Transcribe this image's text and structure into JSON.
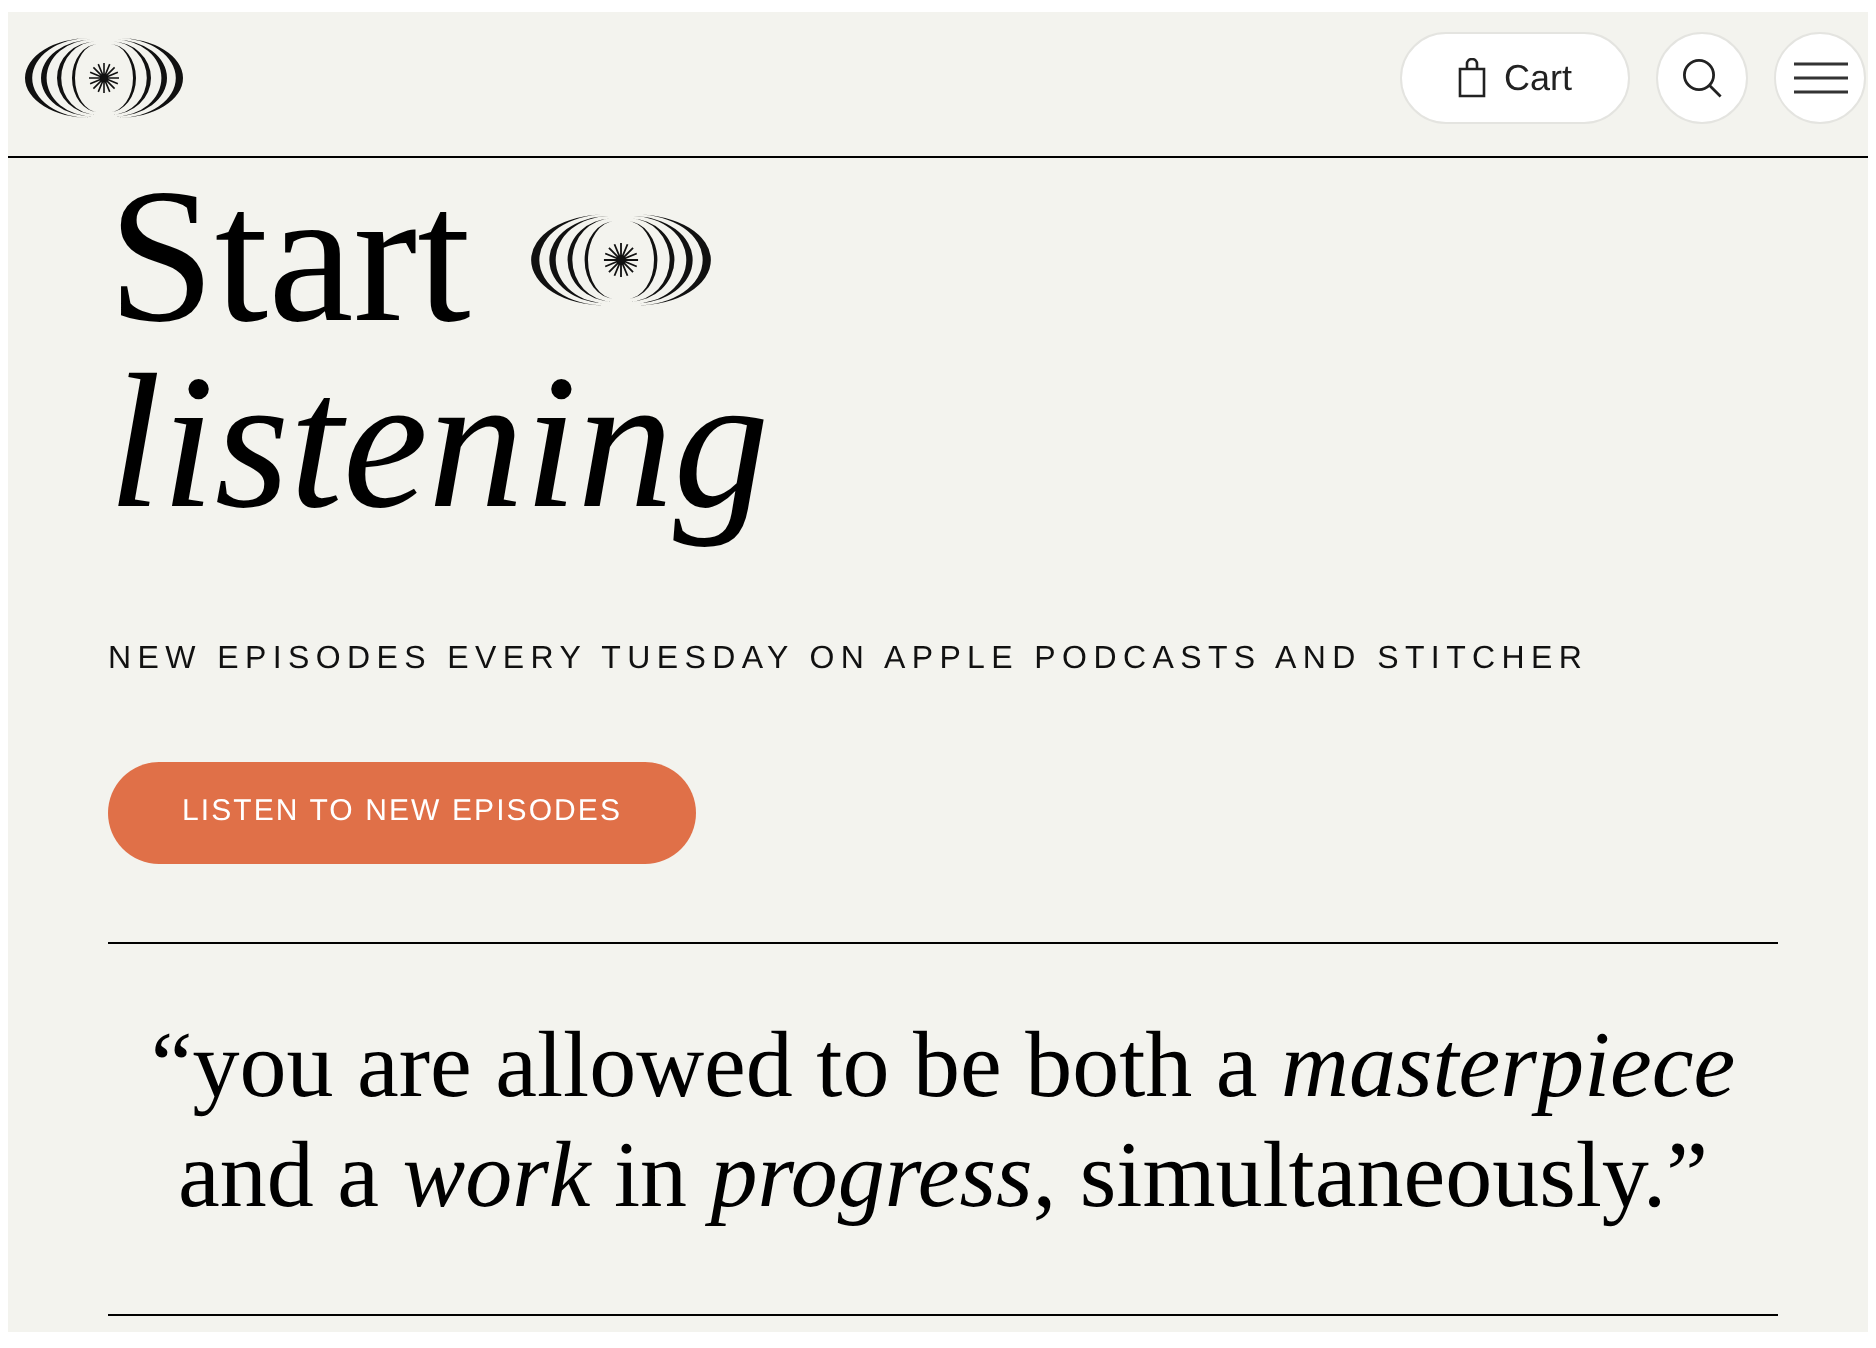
{
  "header": {
    "cart_button": {
      "label": "Cart"
    }
  },
  "hero": {
    "title_line_1": "Start",
    "title_line_2": "listening",
    "subtitle": "NEW EPISODES EVERY TUESDAY ON APPLE PODCASTS AND STITCHER",
    "cta_button": {
      "label": "LISTEN TO NEW EPISODES"
    }
  },
  "quote": {
    "text": "“you are allowed to be both a *masterpiece* and a *work* in *progress*, simultaneously.”"
  }
}
